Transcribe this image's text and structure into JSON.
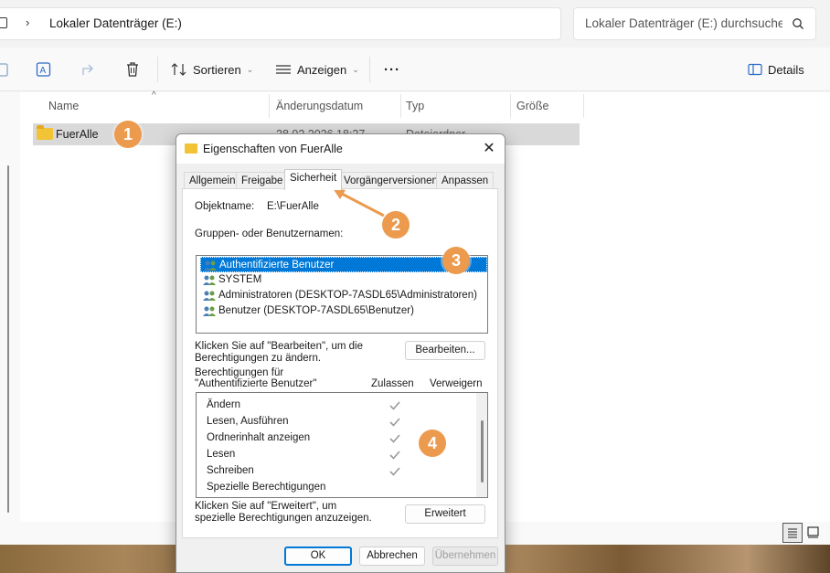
{
  "explorer": {
    "address": "Lokaler Datenträger (E:)",
    "search_placeholder": "Lokaler Datenträger (E:) durchsuchen",
    "toolbar": {
      "sort_label": "Sortieren",
      "view_label": "Anzeigen",
      "more_label": "···",
      "details_label": "Details"
    },
    "columns": {
      "name": "Name",
      "date": "Änderungsdatum",
      "type": "Typ",
      "size": "Größe"
    },
    "rows": [
      {
        "name": "FuerAlle",
        "date": "28.02.2026 18:27",
        "type": "Dateiordner"
      }
    ]
  },
  "dialog": {
    "title": "Eigenschaften von FuerAlle",
    "close_label": "✕",
    "tabs": [
      "Allgemein",
      "Freigabe",
      "Sicherheit",
      "Vorgängerversionen",
      "Anpassen"
    ],
    "active_tab": "Sicherheit",
    "object_label": "Objektname:",
    "object_value": "E:\\FuerAlle",
    "groups_label": "Gruppen- oder Benutzernamen:",
    "groups": [
      "Authentifizierte Benutzer",
      "SYSTEM",
      "Administratoren (DESKTOP-7ASDL65\\Administratoren)",
      "Benutzer (DESKTOP-7ASDL65\\Benutzer)"
    ],
    "edit_hint": "Klicken Sie auf \"Bearbeiten\", um die Berechtigungen zu ändern.",
    "edit_button": "Bearbeiten...",
    "perm_header": "Berechtigungen für \"Authentifizierte Benutzer\"",
    "allow_col": "Zulassen",
    "deny_col": "Verweigern",
    "permissions": [
      {
        "name": "Ändern",
        "allow": true
      },
      {
        "name": "Lesen, Ausführen",
        "allow": true
      },
      {
        "name": "Ordnerinhalt anzeigen",
        "allow": true
      },
      {
        "name": "Lesen",
        "allow": true
      },
      {
        "name": "Schreiben",
        "allow": true
      },
      {
        "name": "Spezielle Berechtigungen",
        "allow": false
      }
    ],
    "advanced_hint": "Klicken Sie auf \"Erweitert\", um spezielle Berechtigungen anzuzeigen.",
    "advanced_button": "Erweitert",
    "ok_button": "OK",
    "cancel_button": "Abbrechen",
    "apply_button": "Übernehmen"
  },
  "annotations": [
    "1",
    "2",
    "3",
    "4"
  ],
  "colors": {
    "accent": "#0078d7",
    "badge": "#eb9a4e",
    "folder": "#f2c335"
  }
}
